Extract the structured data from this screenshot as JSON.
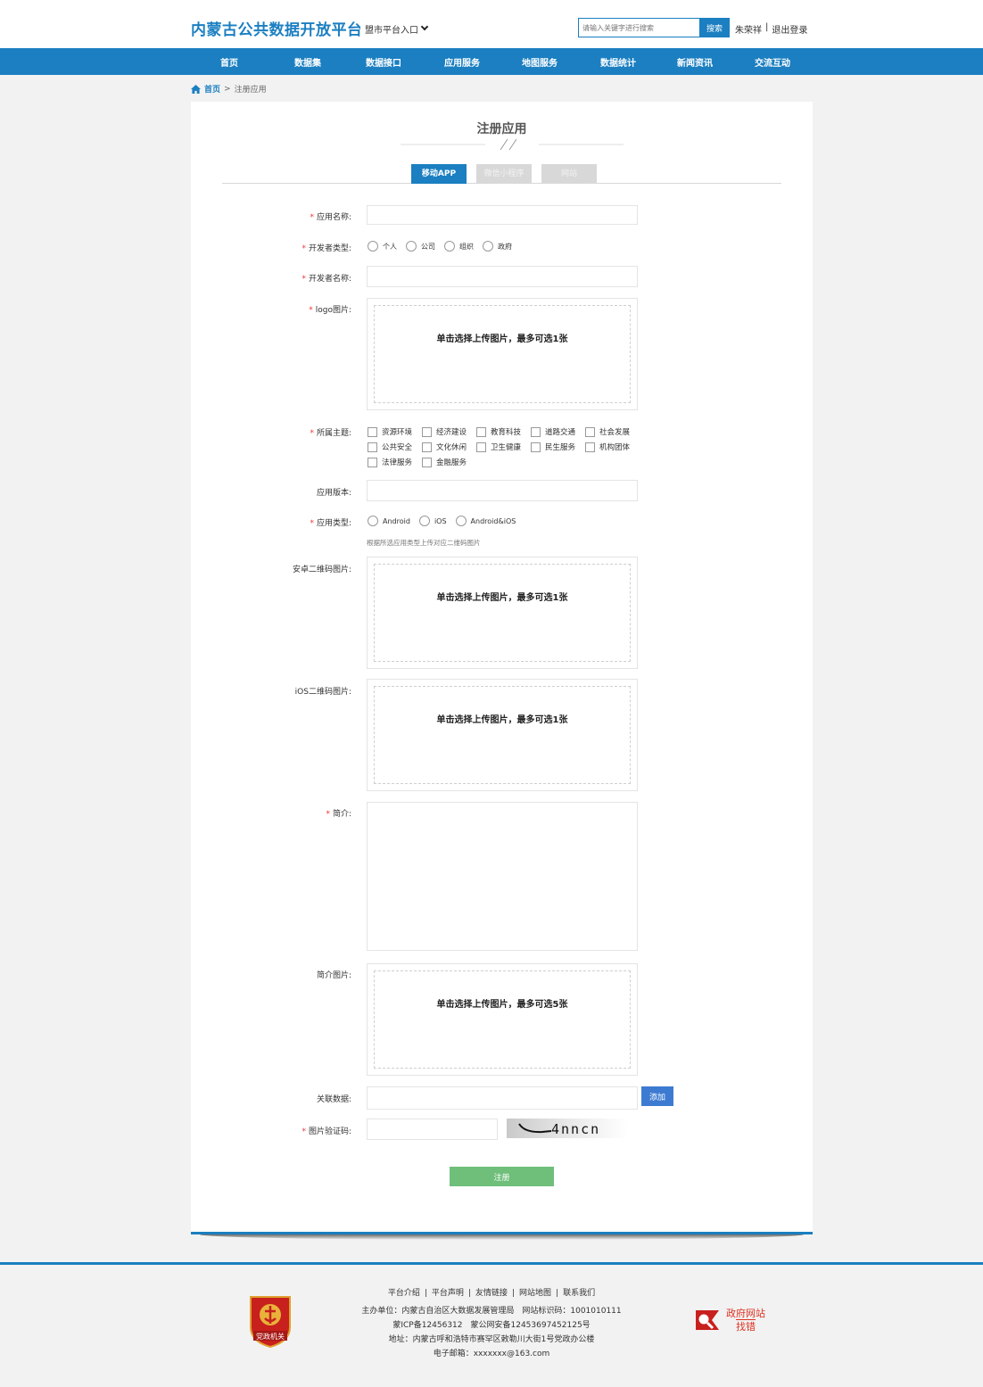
{
  "header": {
    "site_title": "内蒙古公共数据开放平台",
    "platform_select": "盟市平台入口",
    "search_placeholder": "请输入关键字进行搜索",
    "search_button": "搜索",
    "user_name": "朱荣祥",
    "separator": "|",
    "logout": "退出登录"
  },
  "nav": {
    "items": [
      "首页",
      "数据集",
      "数据接口",
      "应用服务",
      "地图服务",
      "数据统计",
      "新闻资讯",
      "交流互动"
    ]
  },
  "breadcrumb": {
    "home": "首页",
    "sep": ">",
    "current": "注册应用"
  },
  "form": {
    "page_title": "注册应用",
    "tabs": [
      {
        "label": "移动APP",
        "active": true
      },
      {
        "label": "微信小程序",
        "active": false
      },
      {
        "label": "网站",
        "active": false
      }
    ],
    "required_mark": "*",
    "labels": {
      "app_name": "应用名称:",
      "dev_type": "开发者类型:",
      "dev_name": "开发者名称:",
      "logo": "logo图片:",
      "topic": "所属主题:",
      "version": "应用版本:",
      "app_type": "应用类型:",
      "android_qr": "安卓二维码图片:",
      "ios_qr": "iOS二维码图片:",
      "intro": "简介:",
      "intro_images": "简介图片:",
      "related_data": "关联数据:",
      "captcha": "图片验证码:"
    },
    "dev_type_options": [
      "个人",
      "公司",
      "组织",
      "政府"
    ],
    "topics": [
      "资源环境",
      "经济建设",
      "教育科技",
      "道路交通",
      "社会发展",
      "公共安全",
      "文化休闲",
      "卫生健康",
      "民生服务",
      "机构团体",
      "法律服务",
      "金融服务"
    ],
    "app_type_options": [
      "Android",
      "iOS",
      "Android&iOS"
    ],
    "app_type_hint": "根据所选应用类型上传对应二维码图片",
    "upload_one": "单击选择上传图片，最多可选1张",
    "upload_five": "单击选择上传图片，最多可选5张",
    "add_button": "添加",
    "captcha_text": "4nncn",
    "register_button": "注册"
  },
  "footer": {
    "links": [
      "平台介绍",
      "平台声明",
      "友情链接",
      "网站地图",
      "联系我们"
    ],
    "link_sep": "|",
    "sponsor": "主办单位：内蒙古自治区大数据发展管理局　网站标识码：1001010111",
    "icp": "蒙ICP备12456312　蒙公网安备12453697452125号",
    "address": "地址：内蒙古呼和浩特市赛罕区敕勒川大街1号党政办公楼",
    "email": "电子邮箱：xxxxxxx@163.com",
    "emblem_text": "党政机关",
    "gov_badge_line1": "政府网站",
    "gov_badge_line2": "找错"
  },
  "colors": {
    "primary": "#1b7fc1",
    "required": "#e33333",
    "register": "#6fbf7b",
    "emblem": "#c8201d"
  }
}
